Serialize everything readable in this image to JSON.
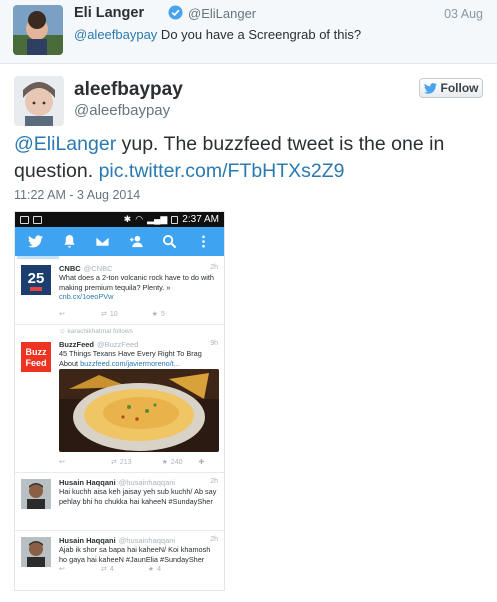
{
  "context_tweet": {
    "name": "Eli Langer",
    "handle": "@EliLanger",
    "date": "03 Aug",
    "mention": "@aleefbaypay",
    "text": " Do you have a Screengrab of this?"
  },
  "main_tweet": {
    "name": "aleefbaypay",
    "handle": "@aleefbaypay",
    "follow_label": "Follow",
    "mention": "@EliLanger",
    "text": " yup. The buzzfeed tweet is the one in question. ",
    "link": "pic.twitter.com/FTbHTXs2Z9",
    "timestamp": "11:22 AM - 3 Aug 2014"
  },
  "screenshot": {
    "status_time": "2:37 AM",
    "tweets": [
      {
        "name": "CNBC",
        "handle": "@CNBC",
        "time": "2h",
        "text": "What does a 2-ton volcanic rock have to do with making premium tequila? Plenty. »",
        "link": "cnb.cx/1oeoPVw",
        "retweets": "10",
        "favorites": "5",
        "avatar_label": "25"
      },
      {
        "follows_line": "karachikhatmal follows",
        "name": "BuzzFeed",
        "handle": "@BuzzFeed",
        "time": "9h",
        "text": "45 Things Texans Have Every Right To Brag About ",
        "link": "buzzfeed.com/javiermoreno/t...",
        "retweets": "213",
        "favorites": "240",
        "avatar_line1": "Buzz",
        "avatar_line2": "Feed"
      },
      {
        "name": "Husain Haqqani",
        "handle": "@husainhaqqani",
        "time": "2h",
        "text": "Hai kuchh aisa keh jaisay yeh sub kuchh/ Ab say pehlay bhi ho chukka hai kaheeN #SundaySher"
      },
      {
        "name": "Husain Haqqani",
        "handle": "@husainhaqqani",
        "time": "2h",
        "text": "Ajab ik shor sa bapa hai kaheeN/ Koi khamosh ho gaya hai kaheeN #JaunElia #SundaySher",
        "retweets": "4",
        "favorites": "4"
      }
    ]
  },
  "colors": {
    "link": "#2a7ab0",
    "twitter_blue": "#3ea3f0",
    "buzzfeed_red": "#ee3322"
  }
}
